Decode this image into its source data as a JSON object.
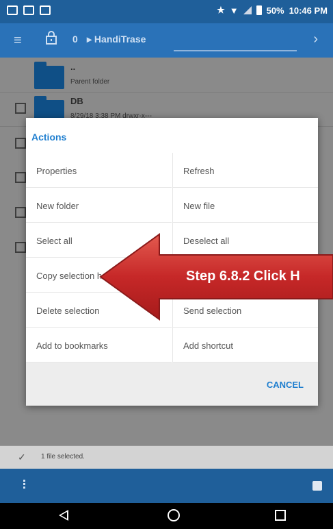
{
  "status_bar": {
    "battery": "50%",
    "time": "10:46 PM"
  },
  "toolbar": {
    "menu_icon": "hamburger-icon",
    "lock_icon": "lock-icon",
    "count": "0",
    "breadcrumb": "HandiTrase",
    "next_icon": "chevron-right-icon"
  },
  "files": [
    {
      "name": "..",
      "sub": "Parent folder"
    },
    {
      "name": "DB",
      "sub": "8/29/18 3:38 PM   drwxr-x---"
    }
  ],
  "dialog": {
    "title": "Actions",
    "items": [
      [
        "Properties",
        "Refresh"
      ],
      [
        "New folder",
        "New file"
      ],
      [
        "Select all",
        "Deselect all"
      ],
      [
        "Copy selection here",
        ""
      ],
      [
        "Delete selection",
        "Send selection"
      ],
      [
        "Add to bookmarks",
        "Add shortcut"
      ]
    ],
    "cancel": "CANCEL"
  },
  "callout": {
    "text": "Step 6.8.2 Click H",
    "color": "#c62828"
  },
  "selection_bar": {
    "text": "1 file selected."
  },
  "colors": {
    "accent": "#1e7ecf",
    "appbar": "#2a72b8"
  }
}
